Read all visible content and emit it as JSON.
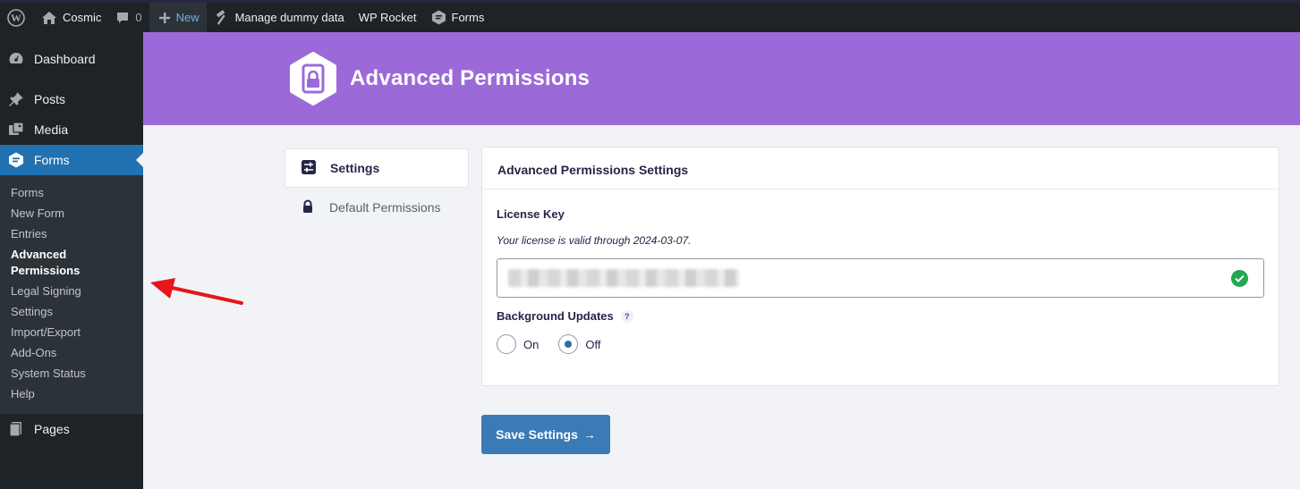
{
  "adminbar": {
    "site_name": "Cosmic",
    "comments_count": "0",
    "new_label": "New",
    "manage_label": "Manage dummy data",
    "wprocket_label": "WP Rocket",
    "forms_label": "Forms"
  },
  "sidebar": {
    "dashboard": "Dashboard",
    "posts": "Posts",
    "media": "Media",
    "forms": "Forms",
    "submenu": [
      "Forms",
      "New Form",
      "Entries",
      "Advanced Permissions",
      "Legal Signing",
      "Settings",
      "Import/Export",
      "Add-Ons",
      "System Status",
      "Help"
    ],
    "pages": "Pages"
  },
  "header": {
    "title": "Advanced Permissions"
  },
  "nav": {
    "settings": "Settings",
    "default_permissions": "Default Permissions"
  },
  "panel": {
    "title": "Advanced Permissions Settings",
    "license_label": "License Key",
    "license_desc": "Your license is valid through 2024-03-07.",
    "background_updates_label": "Background Updates",
    "help_glyph": "?",
    "radio_on": "On",
    "radio_off": "Off",
    "selected": "Off"
  },
  "save_button": {
    "label": "Save Settings",
    "arrow": "→"
  },
  "colors": {
    "banner": "#9b6ad8",
    "wp_blue": "#2271b1",
    "save_button": "#3a7ab5",
    "check_green": "#22a753",
    "annotation_red": "#e8151b"
  },
  "icons": [
    "wordpress-icon",
    "home-icon",
    "comment-icon",
    "plus-icon",
    "hammer-icon",
    "forms-icon",
    "dashboard-icon",
    "pin-icon",
    "media-icon",
    "pages-icon",
    "sliders-icon",
    "lock-icon",
    "check-circle-icon",
    "question-icon"
  ]
}
